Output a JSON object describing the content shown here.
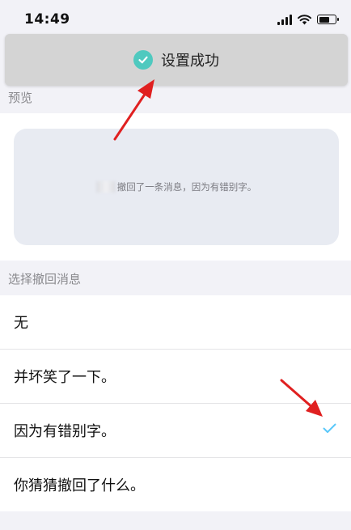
{
  "status_bar": {
    "time": "14:49"
  },
  "toast": {
    "text": "设置成功"
  },
  "preview": {
    "section_label": "预览",
    "message": "撤回了一条消息，因为有错别字。"
  },
  "recall": {
    "section_label": "选择撤回消息",
    "options": [
      {
        "label": "无",
        "selected": false
      },
      {
        "label": "并坏笑了一下。",
        "selected": false
      },
      {
        "label": "因为有错别字。",
        "selected": true
      },
      {
        "label": "你猜猜撤回了什么。",
        "selected": false
      }
    ]
  },
  "colors": {
    "accent_check": "#5ac8fa",
    "toast_check": "#4fc9bf",
    "annotation_arrow": "#e02020"
  }
}
